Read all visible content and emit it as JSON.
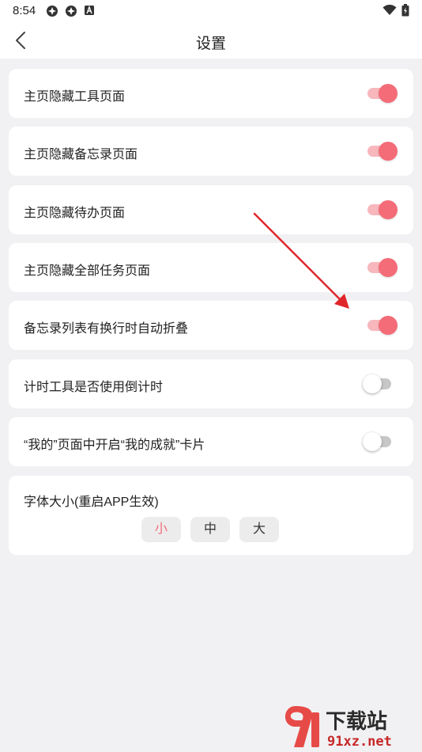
{
  "status_bar": {
    "time": "8:54"
  },
  "header": {
    "title": "设置"
  },
  "settings": [
    {
      "label": "主页隐藏工具页面",
      "enabled": true
    },
    {
      "label": "主页隐藏备忘录页面",
      "enabled": true
    },
    {
      "label": "主页隐藏待办页面",
      "enabled": true
    },
    {
      "label": "主页隐藏全部任务页面",
      "enabled": true
    },
    {
      "label": "备忘录列表有换行时自动折叠",
      "enabled": true
    },
    {
      "label": "计时工具是否使用倒计时",
      "enabled": false
    },
    {
      "label": "“我的”页面中开启“我的成就”卡片",
      "enabled": false
    }
  ],
  "font_size": {
    "label": "字体大小(重启APP生效)",
    "options": [
      "小",
      "中",
      "大"
    ],
    "selected": "小"
  },
  "colors": {
    "accent": "#f46c78",
    "accent_track": "#f7b7bd",
    "annotation_arrow": "#e0262b"
  },
  "watermark": {
    "brand": "下载站",
    "url": "91xz.net"
  }
}
